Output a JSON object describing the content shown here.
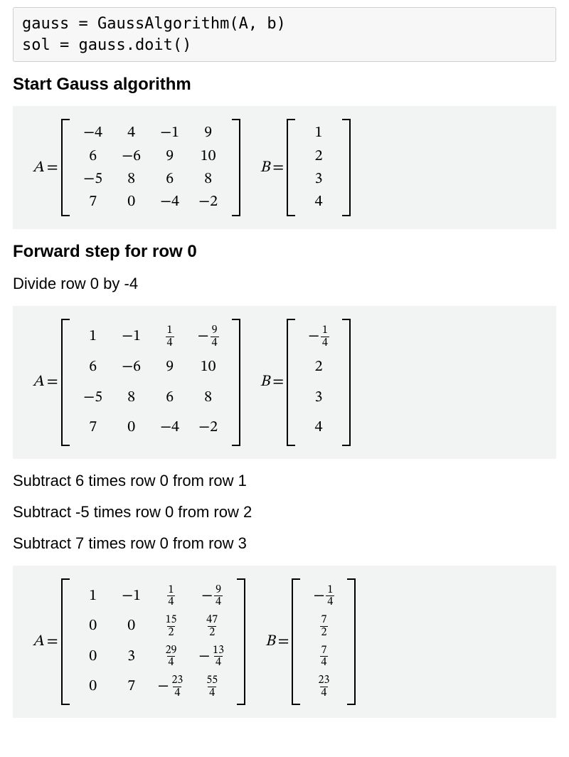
{
  "code": "gauss = GaussAlgorithm(A, b)\nsol = gauss.doit()",
  "headings": {
    "start": "Start Gauss algorithm",
    "forward0": "Forward step for row 0"
  },
  "steps": {
    "divide0": "Divide row 0 by -4",
    "sub1": "Subtract 6 times row 0 from row 1",
    "sub2": "Subtract -5 times row 0 from row 2",
    "sub3": "Subtract 7 times row 0 from row 3"
  },
  "labels": {
    "A": "A",
    "B": "B",
    "eq": "="
  },
  "matrices": {
    "m1": {
      "A": [
        [
          {
            "t": "int",
            "v": "−4"
          },
          {
            "t": "int",
            "v": "4"
          },
          {
            "t": "int",
            "v": "−1"
          },
          {
            "t": "int",
            "v": "9"
          }
        ],
        [
          {
            "t": "int",
            "v": "6"
          },
          {
            "t": "int",
            "v": "−6"
          },
          {
            "t": "int",
            "v": "9"
          },
          {
            "t": "int",
            "v": "10"
          }
        ],
        [
          {
            "t": "int",
            "v": "−5"
          },
          {
            "t": "int",
            "v": "8"
          },
          {
            "t": "int",
            "v": "6"
          },
          {
            "t": "int",
            "v": "8"
          }
        ],
        [
          {
            "t": "int",
            "v": "7"
          },
          {
            "t": "int",
            "v": "0"
          },
          {
            "t": "int",
            "v": "−4"
          },
          {
            "t": "int",
            "v": "−2"
          }
        ]
      ],
      "B": [
        [
          {
            "t": "int",
            "v": "1"
          }
        ],
        [
          {
            "t": "int",
            "v": "2"
          }
        ],
        [
          {
            "t": "int",
            "v": "3"
          }
        ],
        [
          {
            "t": "int",
            "v": "4"
          }
        ]
      ]
    },
    "m2": {
      "A": [
        [
          {
            "t": "int",
            "v": "1"
          },
          {
            "t": "int",
            "v": "−1"
          },
          {
            "t": "frac",
            "n": "1",
            "d": "4"
          },
          {
            "t": "negfrac",
            "n": "9",
            "d": "4"
          }
        ],
        [
          {
            "t": "int",
            "v": "6"
          },
          {
            "t": "int",
            "v": "−6"
          },
          {
            "t": "int",
            "v": "9"
          },
          {
            "t": "int",
            "v": "10"
          }
        ],
        [
          {
            "t": "int",
            "v": "−5"
          },
          {
            "t": "int",
            "v": "8"
          },
          {
            "t": "int",
            "v": "6"
          },
          {
            "t": "int",
            "v": "8"
          }
        ],
        [
          {
            "t": "int",
            "v": "7"
          },
          {
            "t": "int",
            "v": "0"
          },
          {
            "t": "int",
            "v": "−4"
          },
          {
            "t": "int",
            "v": "−2"
          }
        ]
      ],
      "B": [
        [
          {
            "t": "negfrac",
            "n": "1",
            "d": "4"
          }
        ],
        [
          {
            "t": "int",
            "v": "2"
          }
        ],
        [
          {
            "t": "int",
            "v": "3"
          }
        ],
        [
          {
            "t": "int",
            "v": "4"
          }
        ]
      ]
    },
    "m3": {
      "A": [
        [
          {
            "t": "int",
            "v": "1"
          },
          {
            "t": "int",
            "v": "−1"
          },
          {
            "t": "frac",
            "n": "1",
            "d": "4"
          },
          {
            "t": "negfrac",
            "n": "9",
            "d": "4"
          }
        ],
        [
          {
            "t": "int",
            "v": "0"
          },
          {
            "t": "int",
            "v": "0"
          },
          {
            "t": "frac",
            "n": "15",
            "d": "2"
          },
          {
            "t": "frac",
            "n": "47",
            "d": "2"
          }
        ],
        [
          {
            "t": "int",
            "v": "0"
          },
          {
            "t": "int",
            "v": "3"
          },
          {
            "t": "frac",
            "n": "29",
            "d": "4"
          },
          {
            "t": "negfrac",
            "n": "13",
            "d": "4"
          }
        ],
        [
          {
            "t": "int",
            "v": "0"
          },
          {
            "t": "int",
            "v": "7"
          },
          {
            "t": "negfrac",
            "n": "23",
            "d": "4"
          },
          {
            "t": "frac",
            "n": "55",
            "d": "4"
          }
        ]
      ],
      "B": [
        [
          {
            "t": "negfrac",
            "n": "1",
            "d": "4"
          }
        ],
        [
          {
            "t": "frac",
            "n": "7",
            "d": "2"
          }
        ],
        [
          {
            "t": "frac",
            "n": "7",
            "d": "4"
          }
        ],
        [
          {
            "t": "frac",
            "n": "23",
            "d": "4"
          }
        ]
      ]
    }
  }
}
